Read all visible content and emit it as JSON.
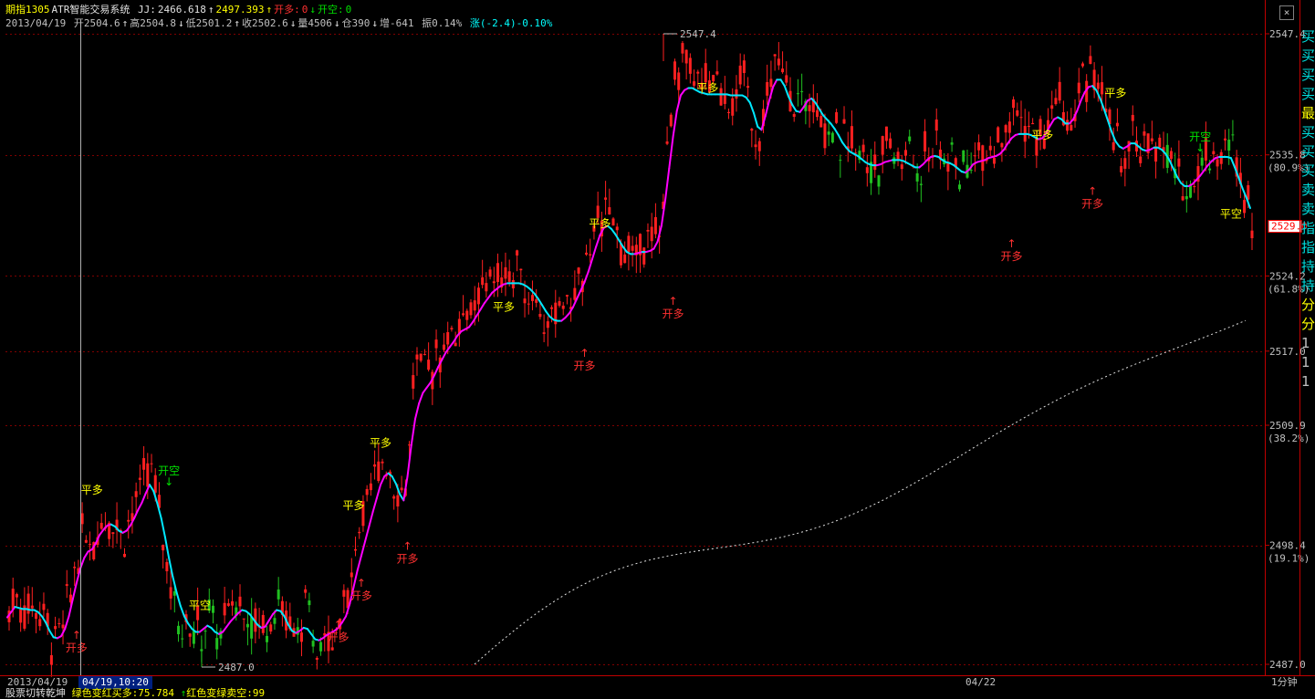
{
  "header": {
    "symbol": "期指1305",
    "system_name": "ATR智能交易系统",
    "jj_label": "JJ:",
    "jj_value": "2466.618",
    "jj2_value": "2497.393",
    "open_long_label": "开多:",
    "open_long_value": "0",
    "open_short_label": "开空:",
    "open_short_value": "0"
  },
  "quote": {
    "date": "2013/04/19",
    "open": "开2504.6",
    "high": "高2504.8",
    "low": "低2501.2",
    "close": "收2502.6",
    "volume": "量4506",
    "position": "仓390",
    "change_pos": "增-641",
    "amplitude": "振0.14%",
    "change": "涨(-2.4)-0.10%"
  },
  "close_button": "×",
  "axis": {
    "date_left": "2013/04/19",
    "date_cursor": "04/19,10:20",
    "date_mid": "04/22",
    "period": "1分钟"
  },
  "subpanel": {
    "title": "股票切转乾坤",
    "text1": "绿色变红买多:75.784",
    "text2": "红色变绿卖空:99"
  },
  "right_strip": [
    "买",
    "买",
    "买",
    "买",
    "最",
    "买",
    "买",
    "买",
    "卖",
    "卖",
    "指",
    "指",
    "持",
    "持",
    "分",
    "分",
    "1",
    "1",
    "1"
  ],
  "colors": {
    "up": "#ff2020",
    "down": "#20c020",
    "ma_up": "#ff00ff",
    "ma_down": "#00e8ff",
    "ma_flat": "#ffff00",
    "grid": "#800000",
    "price_text": "#c0c0c0"
  },
  "chart_data": {
    "type": "candlestick",
    "ylim": [
      2487.0,
      2547.4
    ],
    "y_ticks": [
      {
        "value": 2547.4,
        "label": "2547.4"
      },
      {
        "value": 2535.8,
        "label": "2535.8",
        "sub": "(80.9%)"
      },
      {
        "value": 2524.2,
        "label": "2524.2",
        "sub": "(61.8%)"
      },
      {
        "value": 2517.0,
        "label": "2517.0"
      },
      {
        "value": 2509.9,
        "label": "2509.9",
        "sub": "(38.2%)"
      },
      {
        "value": 2498.4,
        "label": "2498.4",
        "sub": "(19.1%)"
      },
      {
        "value": 2487.0,
        "label": "2487.0"
      }
    ],
    "current_price": "2529.0",
    "high_marker": "2547.4",
    "low_marker": "2487.0",
    "signals": [
      {
        "label": "开多",
        "bar": 18,
        "value": 2490.5,
        "kind": "buy"
      },
      {
        "label": "平多",
        "bar": 22,
        "value": 2503.0,
        "kind": "close"
      },
      {
        "label": "开空",
        "bar": 42,
        "value": 2505.0,
        "kind": "sell"
      },
      {
        "label": "平空",
        "bar": 50,
        "value": 2493.5,
        "kind": "closeshort"
      },
      {
        "label": "开多",
        "bar": 86,
        "value": 2491.5,
        "kind": "buy"
      },
      {
        "label": "开多",
        "bar": 92,
        "value": 2495.5,
        "kind": "buy"
      },
      {
        "label": "平多",
        "bar": 90,
        "value": 2501.5,
        "kind": "close"
      },
      {
        "label": "平多",
        "bar": 97,
        "value": 2507.5,
        "kind": "close"
      },
      {
        "label": "开多",
        "bar": 104,
        "value": 2499.0,
        "kind": "buy"
      },
      {
        "label": "平多",
        "bar": 129,
        "value": 2520.5,
        "kind": "close"
      },
      {
        "label": "开多",
        "bar": 150,
        "value": 2517.5,
        "kind": "buy"
      },
      {
        "label": "平多",
        "bar": 154,
        "value": 2528.5,
        "kind": "close"
      },
      {
        "label": "开多",
        "bar": 173,
        "value": 2522.5,
        "kind": "buy"
      },
      {
        "label": "平多",
        "bar": 182,
        "value": 2541.5,
        "kind": "close"
      },
      {
        "label": "开多",
        "bar": 261,
        "value": 2528.0,
        "kind": "buy"
      },
      {
        "label": "平多",
        "bar": 269,
        "value": 2537.0,
        "kind": "close"
      },
      {
        "label": "开多",
        "bar": 282,
        "value": 2533.0,
        "kind": "buy"
      },
      {
        "label": "平多",
        "bar": 288,
        "value": 2541.0,
        "kind": "close"
      },
      {
        "label": "开空",
        "bar": 310,
        "value": 2537.0,
        "kind": "sell"
      },
      {
        "label": "平空",
        "bar": 318,
        "value": 2531.0,
        "kind": "closeshort"
      }
    ],
    "ma_line": [
      2491.5,
      2492.0,
      2492.5,
      2492.4,
      2492.3,
      2492.3,
      2492.2,
      2492.2,
      2492.0,
      2491.6,
      2491.0,
      2490.2,
      2489.6,
      2489.5,
      2489.7,
      2490.4,
      2491.6,
      2493.2,
      2494.8,
      2496.2,
      2497.2,
      2497.8,
      2498.0,
      2498.6,
      2499.4,
      2499.9,
      2500.3,
      2500.4,
      2500.2,
      2499.8,
      2499.6,
      2499.8,
      2500.3,
      2501.0,
      2501.8,
      2502.5,
      2503.4,
      2504.2,
      2503.6,
      2502.4,
      2501.0,
      2499.2,
      2497.2,
      2495.4,
      2493.9,
      2492.6,
      2491.6,
      2490.9,
      2490.4,
      2490.1,
      2490.1,
      2490.4,
      2490.7,
      2490.5,
      2490.1,
      2489.9,
      2490.1,
      2490.6,
      2491.1,
      2491.5,
      2491.9,
      2492.2,
      2492.1,
      2491.8,
      2491.3,
      2490.8,
      2490.5,
      2490.6,
      2491.2,
      2491.8,
      2492.2,
      2492.1,
      2491.6,
      2490.8,
      2490.2,
      2490.0,
      2490.2,
      2490.5,
      2490.4,
      2489.9,
      2489.4,
      2489.3,
      2489.5,
      2489.8,
      2490.0,
      2490.2,
      2490.5,
      2491.0,
      2491.6,
      2492.8,
      2494.4,
      2496.0,
      2497.4,
      2498.8,
      2500.2,
      2501.6,
      2502.9,
      2504.2,
      2505.0,
      2505.3,
      2505.0,
      2504.3,
      2503.3,
      2502.7,
      2505.0,
      2508.0,
      2510.5,
      2512.0,
      2513.0,
      2513.5,
      2514.0,
      2514.7,
      2515.5,
      2516.2,
      2516.9,
      2517.4,
      2517.9,
      2518.5,
      2518.9,
      2519.1,
      2519.3,
      2519.8,
      2520.4,
      2521.0,
      2521.6,
      2522.1,
      2522.6,
      2522.9,
      2523.2,
      2523.4,
      2523.5,
      2523.5,
      2523.5,
      2523.5,
      2523.4,
      2523.2,
      2522.9,
      2522.5,
      2522.0,
      2521.4,
      2520.8,
      2520.3,
      2520.0,
      2519.9,
      2519.9,
      2520.2,
      2520.6,
      2521.2,
      2522.0,
      2522.8,
      2523.6,
      2524.6,
      2525.8,
      2527.0,
      2528.1,
      2528.8,
      2529.0,
      2528.7,
      2528.2,
      2527.6,
      2527.0,
      2526.5,
      2526.3,
      2526.3,
      2526.4,
      2526.5,
      2526.5,
      2526.6,
      2526.8,
      2527.5,
      2529.0,
      2531.5,
      2534.5,
      2537.5,
      2540.0,
      2541.5,
      2542.0,
      2542.2,
      2542.2,
      2542.0,
      2541.8,
      2541.7,
      2541.6,
      2541.6,
      2541.6,
      2541.6,
      2541.6,
      2541.6,
      2541.5,
      2541.5,
      2541.5,
      2541.5,
      2541.3,
      2540.8,
      2539.8,
      2538.5,
      2538.2,
      2539.5,
      2541.0,
      2542.3,
      2543.0,
      2543.0,
      2542.4,
      2541.4,
      2540.6,
      2540.0,
      2539.9,
      2540.4,
      2541.0,
      2541.2,
      2540.8,
      2540.2,
      2539.6,
      2539.2,
      2538.8,
      2538.3,
      2537.7,
      2537.0,
      2536.5,
      2536.1,
      2535.9,
      2535.7,
      2535.4,
      2535.1,
      2534.9,
      2534.8,
      2534.8,
      2534.9,
      2535.1,
      2535.2,
      2535.3,
      2535.3,
      2535.3,
      2535.2,
      2535.0,
      2534.8,
      2534.6,
      2534.6,
      2534.9,
      2535.3,
      2535.6,
      2535.7,
      2535.6,
      2535.3,
      2535.1,
      2535.0,
      2534.8,
      2534.5,
      2534.2,
      2534.1,
      2534.4,
      2534.9,
      2535.1,
      2535.2,
      2535.3,
      2535.5,
      2535.6,
      2535.7,
      2535.9,
      2536.3,
      2536.9,
      2537.4,
      2537.7,
      2537.8,
      2537.8,
      2537.8,
      2537.7,
      2537.5,
      2537.3,
      2537.4,
      2537.9,
      2538.6,
      2539.2,
      2539.4,
      2539.2,
      2538.8,
      2538.8,
      2539.2,
      2540.0,
      2541.0,
      2541.8,
      2542.3,
      2542.4,
      2542.0,
      2541.2,
      2540.2,
      2539.1,
      2538.0,
      2537.1,
      2536.6,
      2536.4,
      2536.6,
      2536.9,
      2536.9,
      2536.6,
      2536.3,
      2536.2,
      2536.3,
      2536.5,
      2536.5,
      2536.3,
      2535.9,
      2535.3,
      2534.5,
      2533.7,
      2533.1,
      2532.8,
      2532.8,
      2533.0,
      2533.4,
      2533.8,
      2534.3,
      2534.8,
      2535.2,
      2535.5,
      2535.6,
      2535.6,
      2535.6,
      2535.5,
      2534.6,
      2533.6,
      2532.6,
      2531.7,
      2530.7
    ],
    "dotted_line": {
      "start_value": 2487.0,
      "end_value": 2523.6
    }
  }
}
